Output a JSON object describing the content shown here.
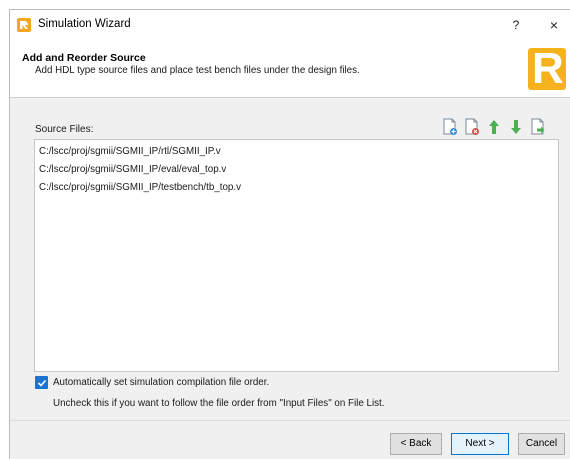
{
  "window": {
    "title": "Simulation Wizard",
    "help_label": "?",
    "close_label": "×"
  },
  "header": {
    "title": "Add and Reorder Source",
    "subtitle": "Add HDL type source files and place test bench files under the design files.",
    "logo_letter": "R"
  },
  "source": {
    "label": "Source Files:",
    "toolbar": [
      "add-file-icon",
      "remove-file-icon",
      "move-up-icon",
      "move-down-icon",
      "import-file-icon"
    ],
    "files": [
      "C:/lscc/proj/sgmii/SGMII_IP/rtl/SGMII_IP.v",
      "C:/lscc/proj/sgmii/SGMII_IP/eval/eval_top.v",
      "C:/lscc/proj/sgmii/SGMII_IP/testbench/tb_top.v"
    ]
  },
  "options": {
    "auto_order_checked": true,
    "auto_order_label": "Automatically set simulation compilation file order.",
    "hint": "Uncheck this if you want to follow the file order from \"Input Files\" on File List."
  },
  "buttons": {
    "back": "< Back",
    "next": "Next >",
    "cancel": "Cancel"
  },
  "colors": {
    "accent": "#1875d1",
    "logo": "#f6b21c",
    "green_arrow": "#4caf50",
    "icon_blue": "#2f8fd8",
    "icon_red": "#e04545"
  }
}
